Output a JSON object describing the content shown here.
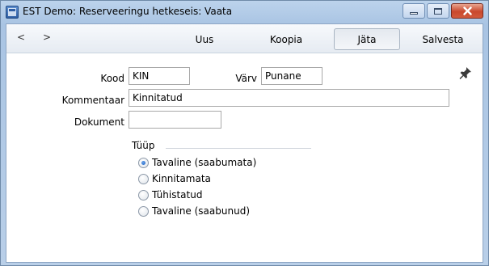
{
  "window": {
    "title": "EST Demo: Reserveeringu hetkeseis: Vaata"
  },
  "toolbar": {
    "back": "<",
    "forward": ">",
    "buttons": [
      {
        "label": "Uus"
      },
      {
        "label": "Koopia"
      },
      {
        "label": "Jäta"
      },
      {
        "label": "Salvesta"
      }
    ]
  },
  "form": {
    "kood": {
      "label": "Kood",
      "value": "KIN"
    },
    "varv": {
      "label": "Värv",
      "value": "Punane"
    },
    "kommentaar": {
      "label": "Kommentaar",
      "value": "Kinnitatud"
    },
    "dokument": {
      "label": "Dokument",
      "value": ""
    }
  },
  "tyyp": {
    "title": "Tüüp",
    "options": [
      {
        "label": "Tavaline (saabumata)",
        "checked": true
      },
      {
        "label": "Kinnitamata",
        "checked": false
      },
      {
        "label": "Tühistatud",
        "checked": false
      },
      {
        "label": "Tavaline (saabunud)",
        "checked": false
      }
    ]
  },
  "colors": {
    "selected_radio": "#1b5fbf",
    "titlebar": "#bcd3ec",
    "close_button": "#c9482d"
  },
  "icons": {
    "app": "app-window-icon",
    "pin": "pushpin-icon"
  }
}
